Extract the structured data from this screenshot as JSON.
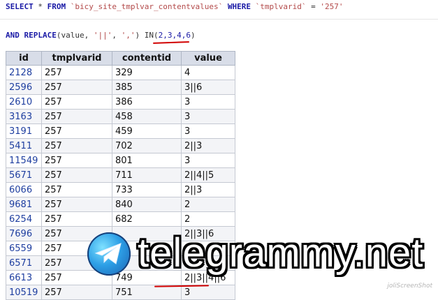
{
  "sql": {
    "line1": {
      "select": "SELECT",
      "star": " * ",
      "from": "FROM",
      "table": " `bicy_site_tmplvar_contentvalues` ",
      "where": "WHERE",
      "field": " `tmplvarid` ",
      "eq": "= ",
      "value": "'257'"
    },
    "line2": {
      "and": "AND",
      "replace": " REPLACE",
      "args_open": "(value, ",
      "arg1": "'||'",
      "comma": ", ",
      "arg2": "','",
      "in": ") IN(",
      "list": "2,3,4,6",
      "close": ")"
    }
  },
  "table": {
    "headers": [
      "id",
      "tmplvarid",
      "contentid",
      "value"
    ],
    "rows": [
      [
        "2128",
        "257",
        "329",
        "4"
      ],
      [
        "2596",
        "257",
        "385",
        "3||6"
      ],
      [
        "2610",
        "257",
        "386",
        "3"
      ],
      [
        "3163",
        "257",
        "458",
        "3"
      ],
      [
        "3191",
        "257",
        "459",
        "3"
      ],
      [
        "5411",
        "257",
        "702",
        "2||3"
      ],
      [
        "11549",
        "257",
        "801",
        "3"
      ],
      [
        "5671",
        "257",
        "711",
        "2||4||5"
      ],
      [
        "6066",
        "257",
        "733",
        "2||3"
      ],
      [
        "9681",
        "257",
        "840",
        "2"
      ],
      [
        "6254",
        "257",
        "682",
        "2"
      ],
      [
        "7696",
        "257",
        "",
        "2||3||6"
      ],
      [
        "6559",
        "257",
        "",
        ""
      ],
      [
        "6571",
        "257",
        "",
        ""
      ],
      [
        "6613",
        "257",
        "749",
        "2||3||4||6"
      ],
      [
        "10519",
        "257",
        "751",
        "3"
      ]
    ]
  },
  "watermark": {
    "text": "telegrammy.net",
    "icon": "telegram-plane-icon"
  },
  "credit": "joliScreenShot",
  "colors": {
    "link": "#1f3fa0",
    "header_bg": "#d8dde8",
    "underline": "#d10000"
  }
}
